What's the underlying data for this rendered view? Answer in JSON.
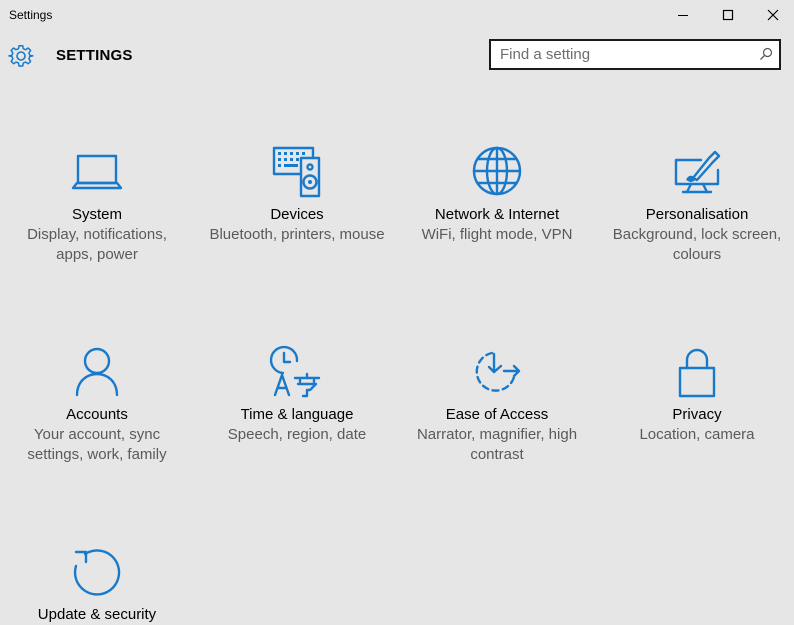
{
  "window": {
    "title": "Settings",
    "controls": {
      "minimize": "minimize-icon",
      "maximize": "maximize-icon",
      "close": "close-icon"
    }
  },
  "header": {
    "icon": "gear-icon",
    "title": "SETTINGS",
    "search": {
      "placeholder": "Find a setting",
      "value": "",
      "icon": "search-icon"
    }
  },
  "colors": {
    "accent": "#1979ca",
    "background": "#e6e6e6",
    "secondary_text": "#5a5a5a"
  },
  "categories": [
    {
      "name": "System",
      "description": "Display, notifications, apps, power",
      "icon": "laptop-icon"
    },
    {
      "name": "Devices",
      "description": "Bluetooth, printers, mouse",
      "icon": "devices-icon"
    },
    {
      "name": "Network & Internet",
      "description": "WiFi, flight mode, VPN",
      "icon": "globe-icon"
    },
    {
      "name": "Personalisation",
      "description": "Background, lock screen, colours",
      "icon": "paint-icon"
    },
    {
      "name": "Accounts",
      "description": "Your account, sync settings, work, family",
      "icon": "person-icon"
    },
    {
      "name": "Time & language",
      "description": "Speech, region, date",
      "icon": "time-language-icon"
    },
    {
      "name": "Ease of Access",
      "description": "Narrator, magnifier, high contrast",
      "icon": "ease-of-access-icon"
    },
    {
      "name": "Privacy",
      "description": "Location, camera",
      "icon": "lock-icon"
    },
    {
      "name": "Update & security",
      "description": "",
      "icon": "update-icon"
    }
  ]
}
